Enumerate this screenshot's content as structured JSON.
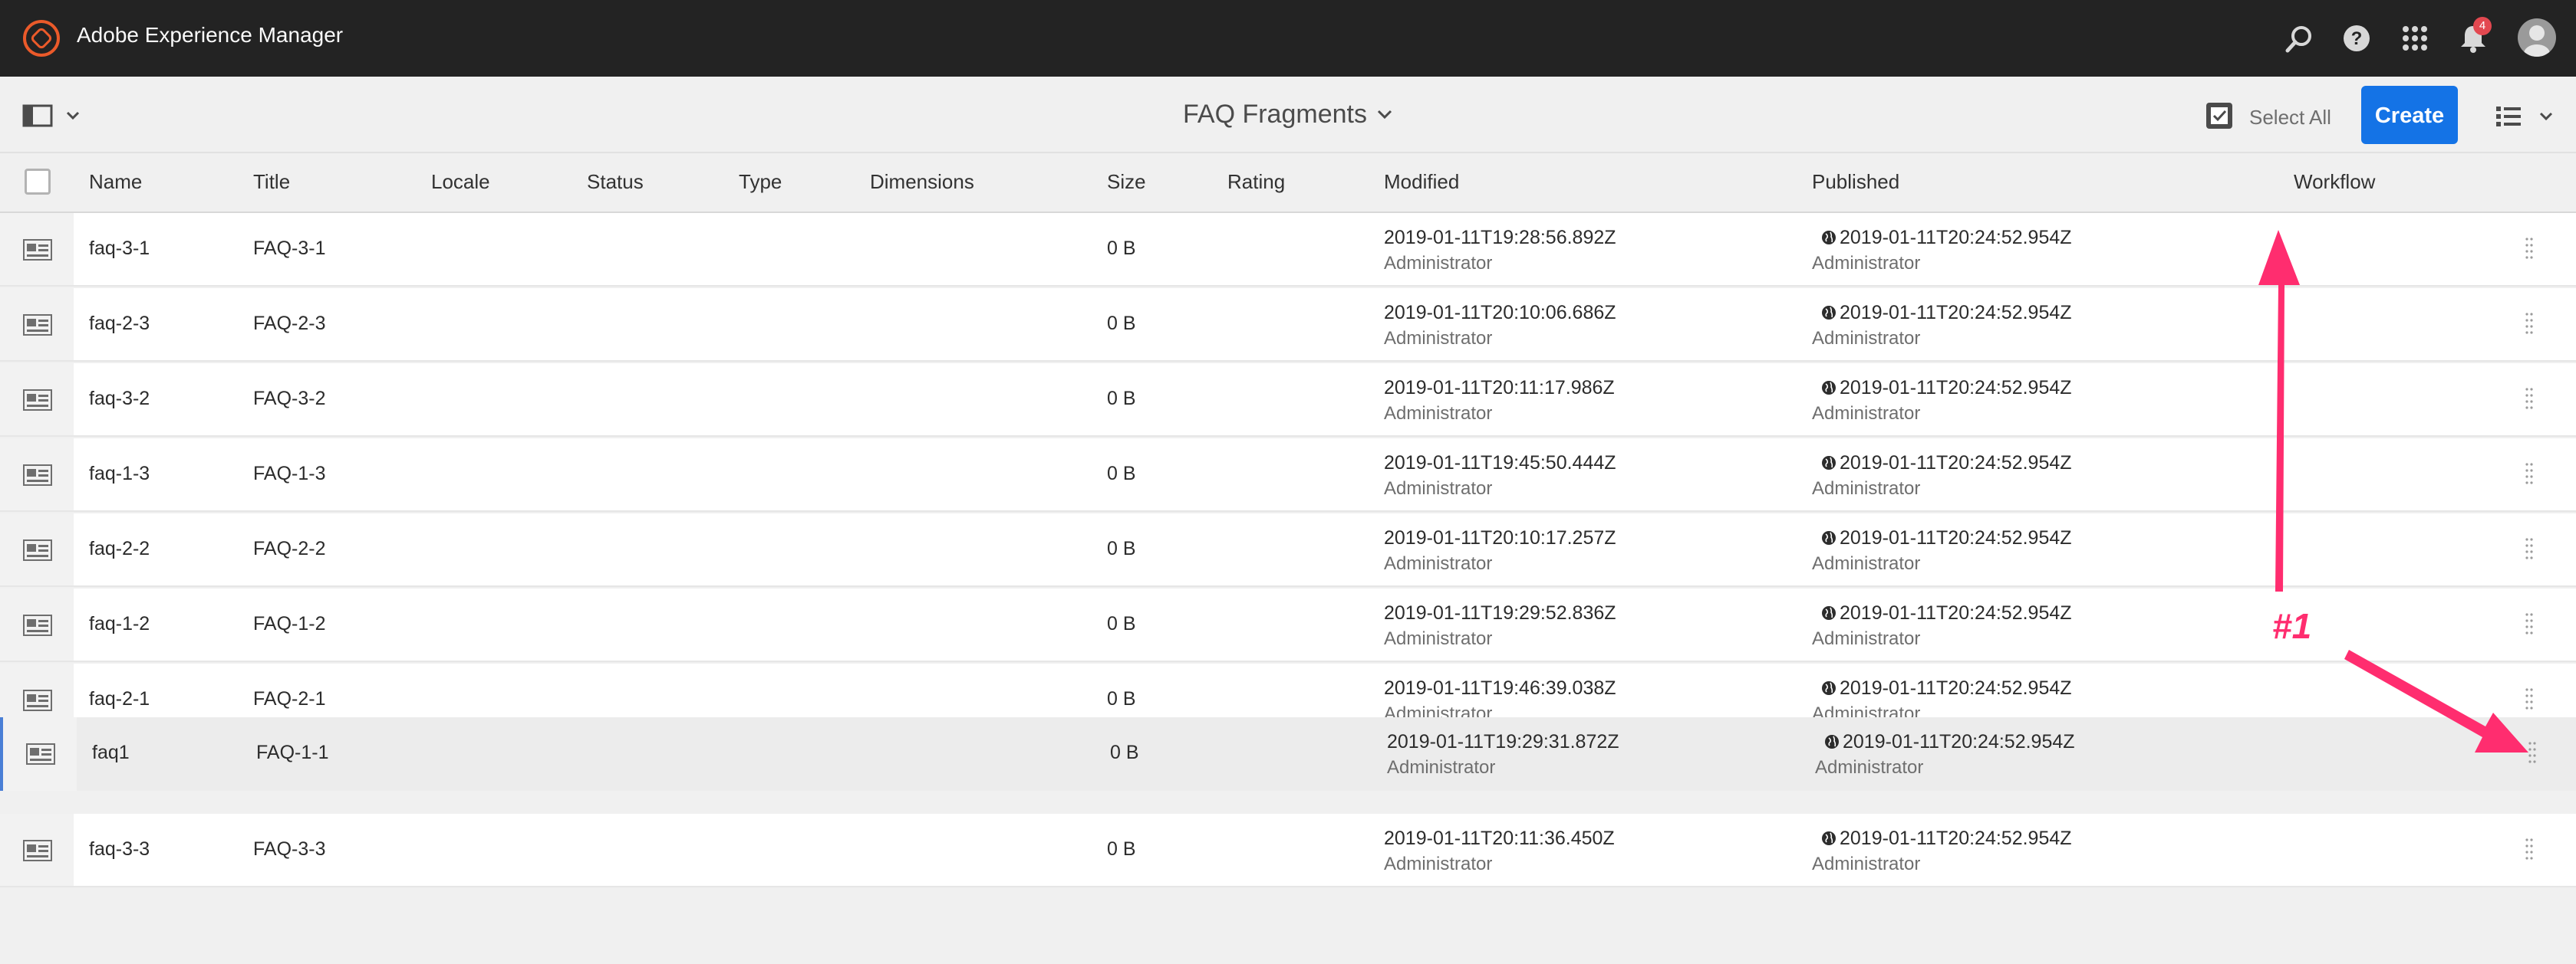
{
  "shell": {
    "app_title": "Adobe Experience Manager",
    "notification_count": "4",
    "icons": [
      "search-icon",
      "help-icon",
      "apps-grid-icon",
      "bell-icon",
      "avatar"
    ]
  },
  "actionbar": {
    "page_title": "FAQ Fragments",
    "select_all_label": "Select All",
    "create_label": "Create"
  },
  "table": {
    "columns": [
      "Name",
      "Title",
      "Locale",
      "Status",
      "Type",
      "Dimensions",
      "Size",
      "Rating",
      "Modified",
      "Published",
      "Workflow"
    ],
    "rows": [
      {
        "name": "faq-3-1",
        "title": "FAQ-3-1",
        "size": "0 B",
        "modified": "2019-01-11T19:28:56.892Z",
        "modified_by": "Administrator",
        "published": "2019-01-11T20:24:52.954Z",
        "published_by": "Administrator"
      },
      {
        "name": "faq-2-3",
        "title": "FAQ-2-3",
        "size": "0 B",
        "modified": "2019-01-11T20:10:06.686Z",
        "modified_by": "Administrator",
        "published": "2019-01-11T20:24:52.954Z",
        "published_by": "Administrator"
      },
      {
        "name": "faq-3-2",
        "title": "FAQ-3-2",
        "size": "0 B",
        "modified": "2019-01-11T20:11:17.986Z",
        "modified_by": "Administrator",
        "published": "2019-01-11T20:24:52.954Z",
        "published_by": "Administrator"
      },
      {
        "name": "faq-1-3",
        "title": "FAQ-1-3",
        "size": "0 B",
        "modified": "2019-01-11T19:45:50.444Z",
        "modified_by": "Administrator",
        "published": "2019-01-11T20:24:52.954Z",
        "published_by": "Administrator"
      },
      {
        "name": "faq-2-2",
        "title": "FAQ-2-2",
        "size": "0 B",
        "modified": "2019-01-11T20:10:17.257Z",
        "modified_by": "Administrator",
        "published": "2019-01-11T20:24:52.954Z",
        "published_by": "Administrator"
      },
      {
        "name": "faq-1-2",
        "title": "FAQ-1-2",
        "size": "0 B",
        "modified": "2019-01-11T19:29:52.836Z",
        "modified_by": "Administrator",
        "published": "2019-01-11T20:24:52.954Z",
        "published_by": "Administrator"
      },
      {
        "name": "faq-2-1",
        "title": "FAQ-2-1",
        "size": "0 B",
        "modified": "2019-01-11T19:46:39.038Z",
        "modified_by": "Administrator",
        "published": "2019-01-11T20:24:52.954Z",
        "published_by": "Administrator"
      },
      {
        "name": "faq1",
        "title": "FAQ-1-1",
        "size": "0 B",
        "modified": "2019-01-11T19:29:31.872Z",
        "modified_by": "Administrator",
        "published": "2019-01-11T20:24:52.954Z",
        "published_by": "Administrator"
      },
      {
        "name": "faq-3-3",
        "title": "FAQ-3-3",
        "size": "0 B",
        "modified": "2019-01-11T20:11:36.450Z",
        "modified_by": "Administrator",
        "published": "2019-01-11T20:24:52.954Z",
        "published_by": "Administrator"
      }
    ]
  },
  "annotation": {
    "label": "#1",
    "color": "#ff2d6f"
  }
}
